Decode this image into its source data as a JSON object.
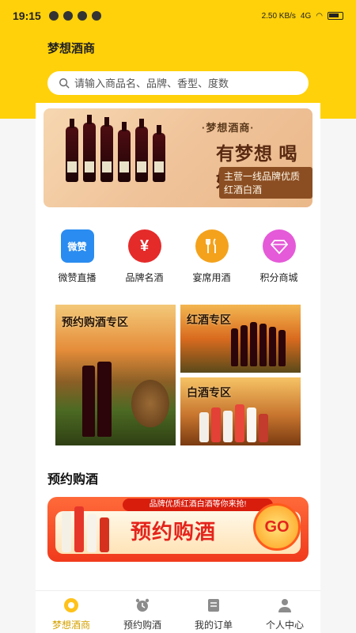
{
  "status": {
    "time": "19:15",
    "network_speed": "2.50 KB/s",
    "signal": "4G",
    "battery": "61"
  },
  "header": {
    "title": "梦想酒商"
  },
  "search": {
    "placeholder": "请输入商品名、品牌、香型、度数"
  },
  "banner": {
    "subtitle": "·梦想酒商·",
    "title": "有梦想 喝好酒!",
    "tagline": "主营一线品牌优质红酒白酒"
  },
  "categories": [
    {
      "label": "微赞直播",
      "icon": "weizan-logo-icon",
      "color": "#2a8cf0",
      "mark": "微赞"
    },
    {
      "label": "品牌名酒",
      "icon": "yen-icon",
      "color": "#e52a2a",
      "mark": "¥"
    },
    {
      "label": "宴席用酒",
      "icon": "fork-knife-icon",
      "color": "#f4a21c",
      "mark": ""
    },
    {
      "label": "积分商城",
      "icon": "diamond-icon",
      "color": "#e55ad8",
      "mark": ""
    }
  ],
  "promos": {
    "main": "预约购酒专区",
    "red": "红酒专区",
    "white": "白酒专区"
  },
  "reserve_section": {
    "title": "预约购酒",
    "strip": "品牌优质红酒白酒等你来抢!",
    "banner_text": "预约购酒",
    "go_label": "GO"
  },
  "tabbar": [
    {
      "label": "梦想酒商",
      "icon": "home-icon",
      "active": true
    },
    {
      "label": "预约购酒",
      "icon": "alarm-clock-icon",
      "active": false
    },
    {
      "label": "我的订单",
      "icon": "order-list-icon",
      "active": false
    },
    {
      "label": "个人中心",
      "icon": "user-icon",
      "active": false
    }
  ],
  "colors": {
    "brand_yellow": "#ffd10a",
    "active_tab": "#d4a100",
    "promo_red": "#f03a1c"
  }
}
